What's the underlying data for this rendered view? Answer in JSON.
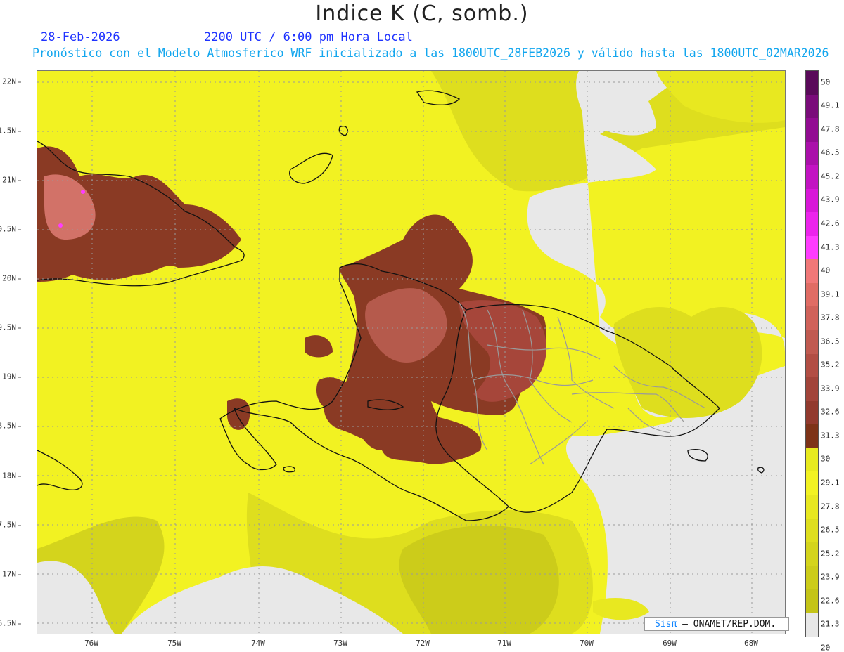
{
  "header": {
    "title": "Indice K (C, somb.)",
    "date": "28-Feb-2026",
    "time": "2200 UTC / 6:00 pm Hora Local",
    "forecast_line": "Pronóstico con el Modelo Atmosferico WRF inicializado a las 1800UTC_28FEB2026 y válido hasta las  1800UTC_02MAR2026"
  },
  "map": {
    "lat_labels": [
      "22N",
      "1.5N",
      "21N",
      "0.5N",
      "20N",
      "9.5N",
      "19N",
      "8.5N",
      "18N",
      "7.5N",
      "17N",
      "6.5N"
    ],
    "lon_labels": [
      "76W",
      "75W",
      "74W",
      "73W",
      "72W",
      "71W",
      "70W",
      "69W",
      "68W"
    ],
    "colors": {
      "no_data": "#e8e8e8",
      "ocean_low": "#c8c81a",
      "mid": "#e0e01c",
      "high": "#f2f222",
      "storm_dark": "#7e3318",
      "storm_mid": "#a8483a",
      "storm_light": "#d27268",
      "coastline": "#111111",
      "borders": "#9a9a9a"
    },
    "regions": [
      "cuba-oriente",
      "haiti-north",
      "haiti-southwest",
      "dominican-cordillera",
      "puerto-rico",
      "bahamas-islands",
      "turks-caicos"
    ]
  },
  "colorbar": {
    "labels": [
      "50",
      "49.1",
      "47.8",
      "46.5",
      "45.2",
      "43.9",
      "42.6",
      "41.3",
      "40",
      "39.1",
      "37.8",
      "36.5",
      "35.2",
      "33.9",
      "32.6",
      "31.3",
      "30",
      "29.1",
      "27.8",
      "26.5",
      "25.2",
      "23.9",
      "22.6",
      "21.3",
      "20"
    ],
    "colors": [
      "#5a0a5a",
      "#7a0c7a",
      "#920c92",
      "#aa10aa",
      "#c214c2",
      "#d818d8",
      "#ec24ec",
      "#ff3cff",
      "#f07878",
      "#e06c64",
      "#d0625a",
      "#c05a50",
      "#b24e44",
      "#a2443a",
      "#923a2e",
      "#7e3318",
      "#e8ea1e",
      "#f2f222",
      "#e8e820",
      "#dede1e",
      "#d4d41c",
      "#cccc1a",
      "#c4c418",
      "#e8e8e8"
    ]
  },
  "credit": {
    "brand": "Sisπ",
    "text": " – ONAMET/REP.DOM."
  }
}
